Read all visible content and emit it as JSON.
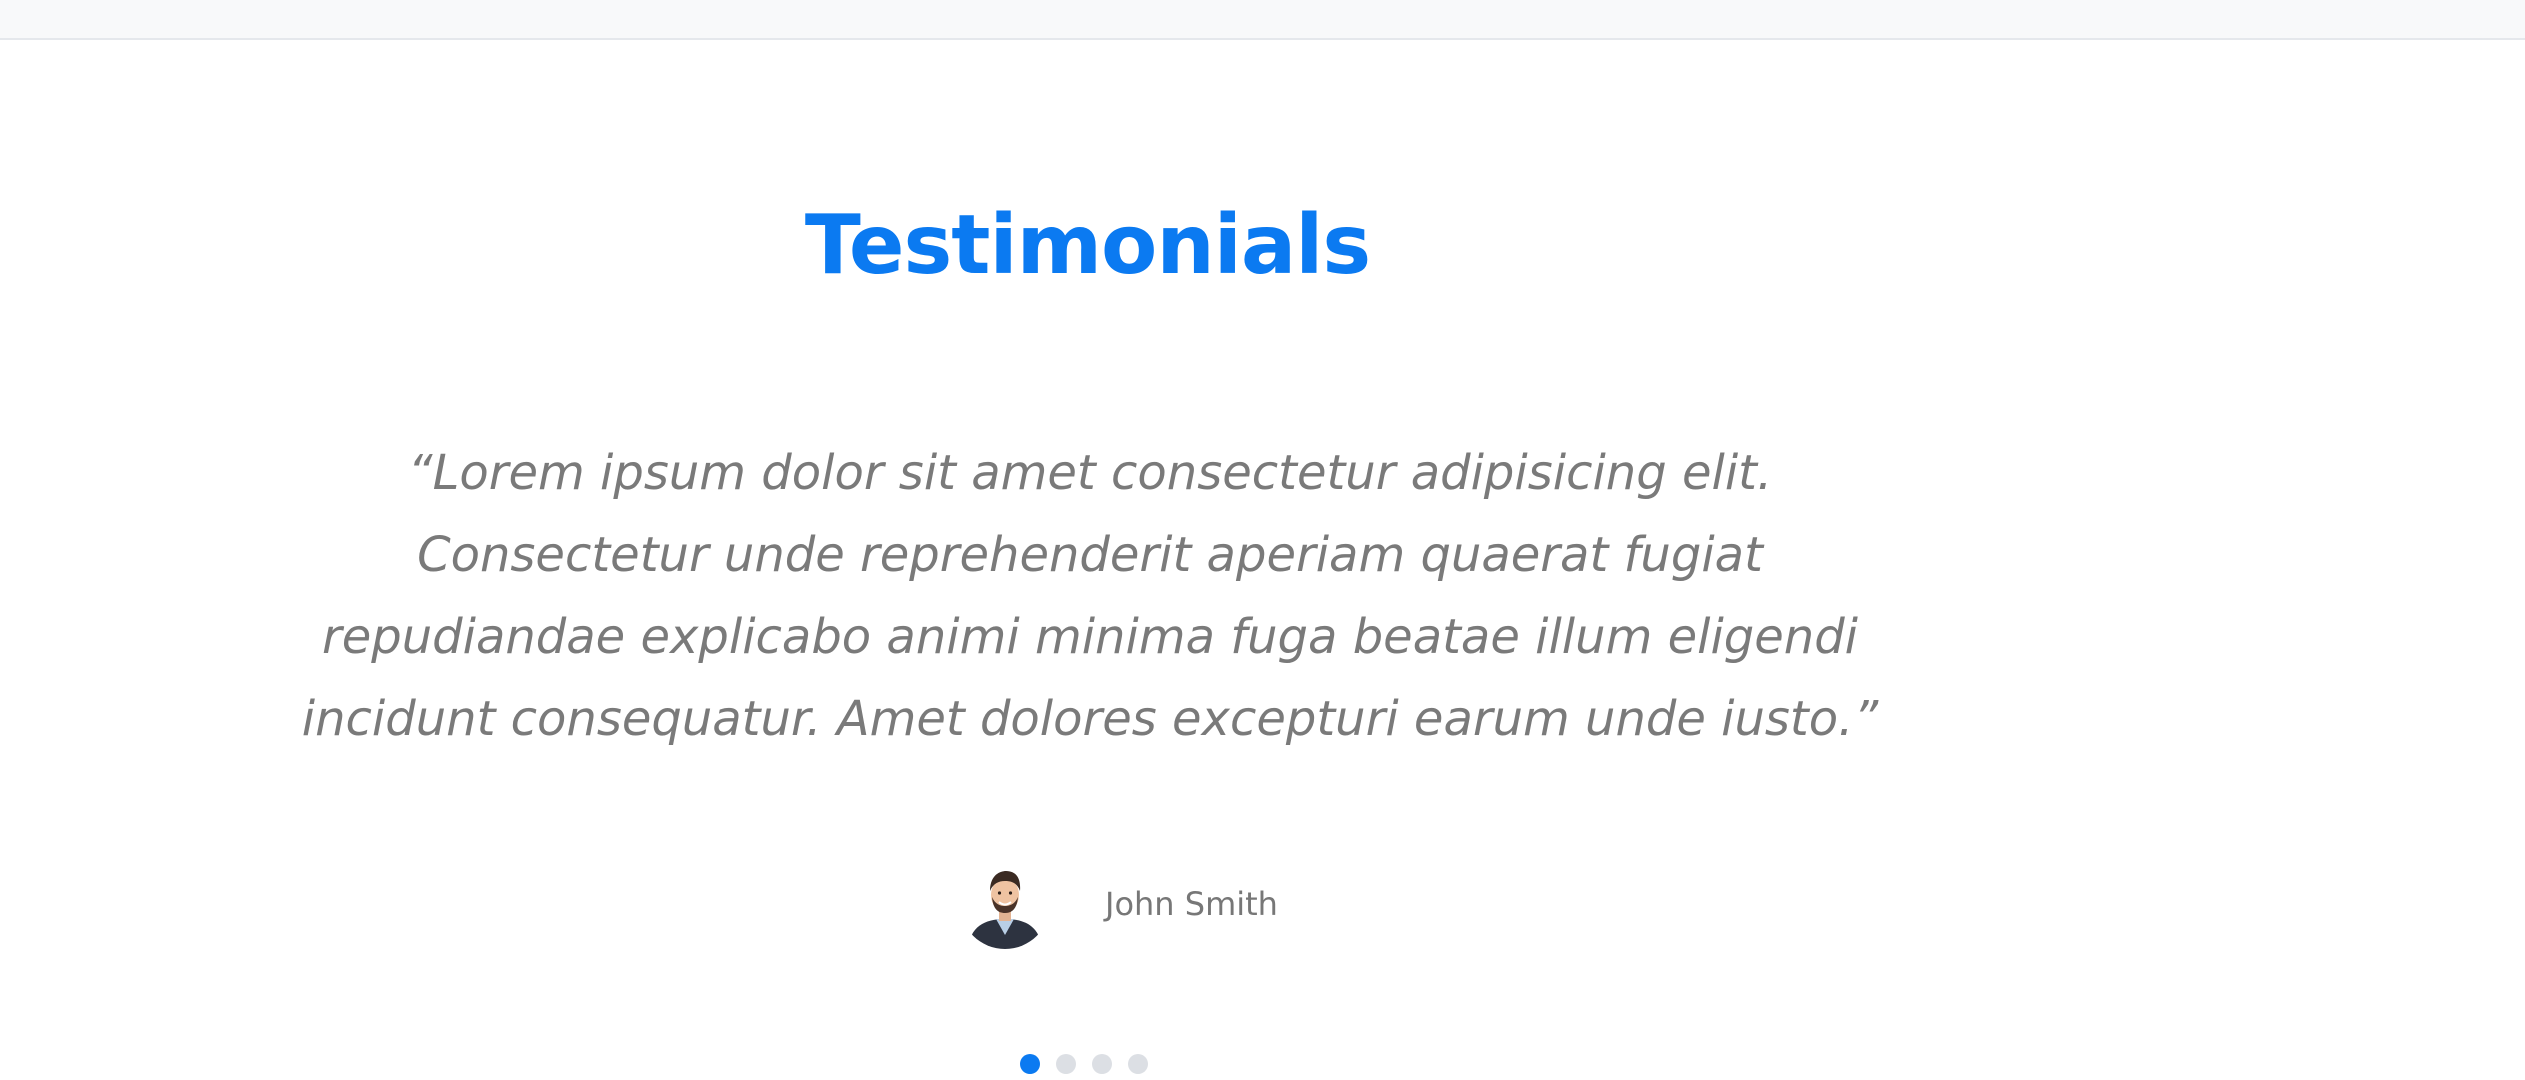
{
  "section": {
    "title": "Testimonials"
  },
  "testimonial": {
    "quote": "“Lorem ipsum dolor sit amet consectetur adipisicing elit. Consectetur unde reprehenderit aperiam quaerat fugiat repudiandae explicabo animi minima fuga beatae illum eligendi incidunt consequatur. Amet dolores excepturi earum unde iusto.”",
    "author": "John Smith",
    "avatar_icon": "person-avatar"
  },
  "carousel": {
    "slide_count": 4,
    "active_index": 0
  },
  "colors": {
    "accent": "#0b7af1",
    "text_muted": "#7a7a7a",
    "dot_inactive": "#dcdfe4",
    "top_strip": "#f8f9fa"
  }
}
